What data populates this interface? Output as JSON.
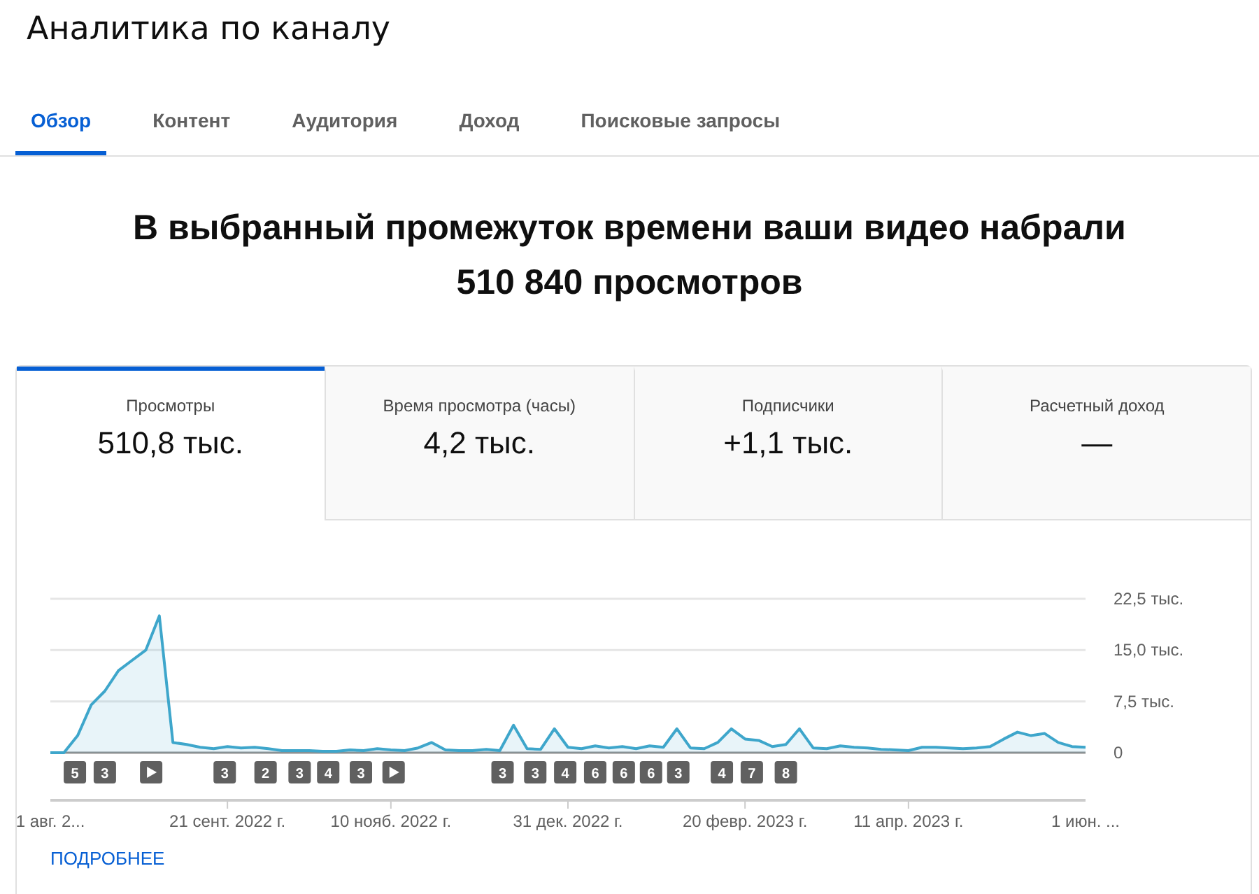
{
  "page_title": "Аналитика по каналу",
  "tabs": [
    {
      "label": "Обзор",
      "selected": true
    },
    {
      "label": "Контент",
      "selected": false
    },
    {
      "label": "Аудитория",
      "selected": false
    },
    {
      "label": "Доход",
      "selected": false
    },
    {
      "label": "Поисковые запросы",
      "selected": false
    }
  ],
  "headline": [
    "В выбранный промежуток времени ваши видео набрали",
    "510 840 просмотров"
  ],
  "metrics": [
    {
      "label": "Просмотры",
      "value": "510,8 тыс.",
      "selected": true
    },
    {
      "label": "Время просмотра (часы)",
      "value": "4,2 тыс.",
      "selected": false
    },
    {
      "label": "Подписчики",
      "value": "+1,1 тыс.",
      "selected": false
    },
    {
      "label": "Расчетный доход",
      "value": "—",
      "selected": false
    }
  ],
  "chart": {
    "chart_data": {
      "type": "area",
      "ylim": [
        0,
        22.5
      ],
      "yticks": [
        {
          "value": 0,
          "label": "0"
        },
        {
          "value": 7.5,
          "label": "7,5 тыс."
        },
        {
          "value": 15,
          "label": "15,0 тыс."
        },
        {
          "value": 22.5,
          "label": "22,5 тыс."
        }
      ],
      "categories": [
        "1 авг. 2...",
        null,
        null,
        null,
        null,
        null,
        null,
        null,
        null,
        null,
        null,
        null,
        null,
        "21 сент. 2022 г.",
        null,
        null,
        null,
        null,
        null,
        null,
        null,
        null,
        null,
        null,
        null,
        "10 нояб. 2022 г.",
        null,
        null,
        null,
        null,
        null,
        null,
        null,
        null,
        null,
        null,
        null,
        null,
        "31 дек. 2022 г.",
        null,
        null,
        null,
        null,
        null,
        null,
        null,
        null,
        null,
        null,
        null,
        null,
        "20 февр. 2023 г.",
        null,
        null,
        null,
        null,
        null,
        null,
        null,
        null,
        null,
        null,
        null,
        "11 апр. 2023 г.",
        null,
        null,
        null,
        null,
        null,
        null,
        null,
        null,
        null,
        null,
        null,
        null,
        "1 июн. ..."
      ],
      "series": [
        {
          "color": "#3ea6cb",
          "values": [
            0,
            0,
            2.5,
            7,
            9,
            12,
            13.5,
            15,
            20,
            1.5,
            1.2,
            0.8,
            0.6,
            0.9,
            0.7,
            0.8,
            0.6,
            0.3,
            0.3,
            0.3,
            0.2,
            0.2,
            0.4,
            0.3,
            0.6,
            0.4,
            0.3,
            0.7,
            1.5,
            0.4,
            0.3,
            0.3,
            0.5,
            0.3,
            4,
            0.6,
            0.5,
            3.5,
            0.8,
            0.6,
            1,
            0.7,
            0.9,
            0.6,
            1,
            0.8,
            3.5,
            0.7,
            0.6,
            1.5,
            3.5,
            2,
            1.8,
            0.9,
            1.2,
            3.5,
            0.7,
            0.6,
            1,
            0.8,
            0.7,
            0.5,
            0.4,
            0.3,
            0.8,
            0.8,
            0.7,
            0.6,
            0.7,
            0.9,
            2,
            3,
            2.5,
            2.8,
            1.5,
            0.9,
            0.8
          ]
        }
      ]
    },
    "markers": [
      {
        "kind": "count",
        "text": "5"
      },
      {
        "kind": "count",
        "text": "3"
      },
      {
        "kind": "play"
      },
      {
        "kind": "count",
        "text": "3"
      },
      {
        "kind": "count",
        "text": "2"
      },
      {
        "kind": "count",
        "text": "3"
      },
      {
        "kind": "count",
        "text": "4"
      },
      {
        "kind": "count",
        "text": "3"
      },
      {
        "kind": "play"
      },
      {
        "kind": "count",
        "text": "3"
      },
      {
        "kind": "count",
        "text": "3"
      },
      {
        "kind": "count",
        "text": "4"
      },
      {
        "kind": "count",
        "text": "6"
      },
      {
        "kind": "count",
        "text": "6"
      },
      {
        "kind": "count",
        "text": "6"
      },
      {
        "kind": "count",
        "text": "3"
      },
      {
        "kind": "count",
        "text": "4"
      },
      {
        "kind": "count",
        "text": "7"
      },
      {
        "kind": "count",
        "text": "8"
      }
    ]
  },
  "more_link": "ПОДРОБНЕЕ"
}
